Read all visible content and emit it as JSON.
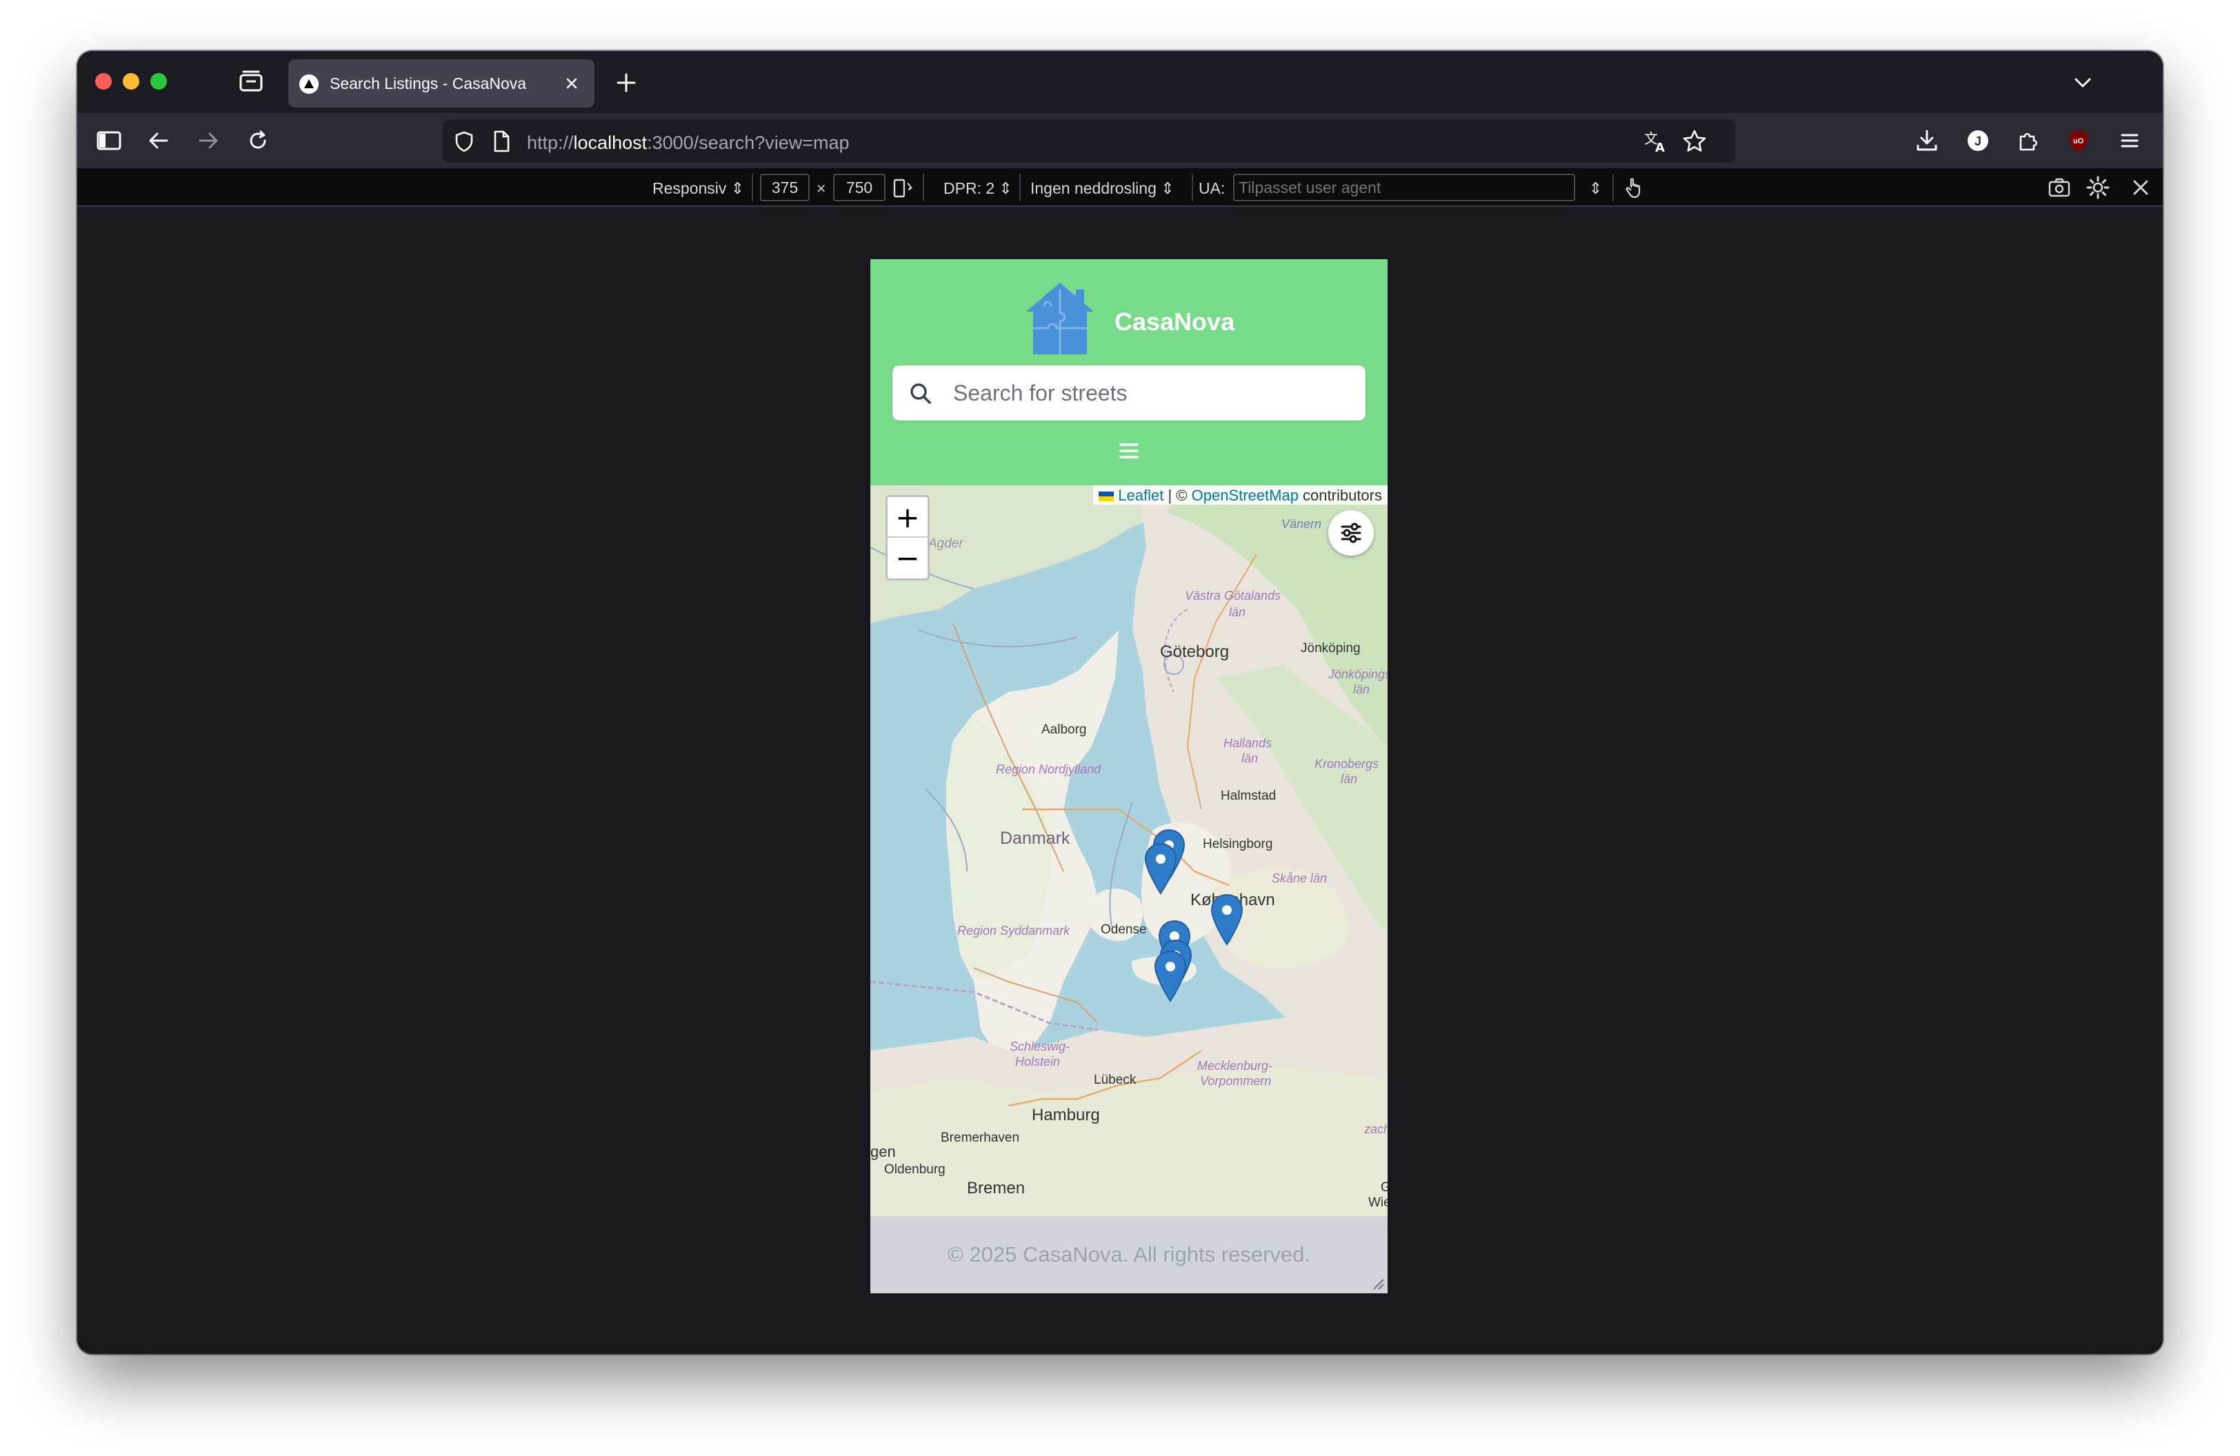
{
  "browser": {
    "tab": {
      "title": "Search Listings - CasaNova"
    },
    "url": {
      "scheme": "http://",
      "host": "localhost",
      "rest": ":3000/search?view=map"
    },
    "icons": {
      "translate": "translate-icon",
      "bookmark": "star-icon",
      "download": "download-icon",
      "account": "account-icon",
      "extensions": "puzzle-icon",
      "ublock": "ublock-icon",
      "menu": "menu-icon"
    }
  },
  "rdm": {
    "device": "Responsiv",
    "width": "375",
    "times": "×",
    "height": "750",
    "dpr": "DPR: 2",
    "throttle": "Ingen neddrosling",
    "ua_label": "UA:",
    "ua_placeholder": "Tilpasset user agent"
  },
  "app": {
    "brand": "CasaNova",
    "search_placeholder": "Search for streets",
    "footer": "© 2025 CasaNova. All rights reserved.",
    "colors": {
      "header": "#77db8a",
      "footer": "#d1d5db",
      "marker": "#2f7ccb"
    }
  },
  "map": {
    "attribution": {
      "leaflet": "Leaflet",
      "sep": " | © ",
      "osm": "OpenStreetMap",
      "suffix": " contributors"
    },
    "zoom_in": "+",
    "zoom_out": "−",
    "labels": [
      {
        "key": "agder",
        "text": "Agder"
      },
      {
        "key": "vanern",
        "text": "Vänern"
      },
      {
        "key": "vastra1",
        "text": "Västra Götalands"
      },
      {
        "key": "vastra2",
        "text": "län"
      },
      {
        "key": "goteborg",
        "text": "Göteborg"
      },
      {
        "key": "jonkoping",
        "text": "Jönköping"
      },
      {
        "key": "jonkopingslan1",
        "text": "Jönköpings"
      },
      {
        "key": "jonkopingslan2",
        "text": "län"
      },
      {
        "key": "aalborg",
        "text": "Aalborg"
      },
      {
        "key": "nordjylland",
        "text": "Region Nordjylland"
      },
      {
        "key": "hallands1",
        "text": "Hallands"
      },
      {
        "key": "hallands2",
        "text": "län"
      },
      {
        "key": "kronobergs1",
        "text": "Kronobergs"
      },
      {
        "key": "kronobergs2",
        "text": "län"
      },
      {
        "key": "halmstad",
        "text": "Halmstad"
      },
      {
        "key": "danmark",
        "text": "Danmark"
      },
      {
        "key": "helsingborg",
        "text": "Helsingborg"
      },
      {
        "key": "skane",
        "text": "Skåne län"
      },
      {
        "key": "kobenhavn",
        "text": "København"
      },
      {
        "key": "syddanmark",
        "text": "Region Syddanmark"
      },
      {
        "key": "odense",
        "text": "Odense"
      },
      {
        "key": "schleswig1",
        "text": "Schleswig-"
      },
      {
        "key": "schleswig2",
        "text": "Holstein"
      },
      {
        "key": "lubeck",
        "text": "Lübeck"
      },
      {
        "key": "mecklenburg1",
        "text": "Mecklenburg-"
      },
      {
        "key": "mecklenburg2",
        "text": "Vorpommern"
      },
      {
        "key": "hamburg",
        "text": "Hamburg"
      },
      {
        "key": "bremerhaven",
        "text": "Bremerhaven"
      },
      {
        "key": "oldenburg",
        "text": "Oldenburg"
      },
      {
        "key": "bremen",
        "text": "Bremen"
      },
      {
        "key": "gen",
        "text": "gen"
      },
      {
        "key": "zach",
        "text": "zach"
      },
      {
        "key": "wie",
        "text": "Wie"
      },
      {
        "key": "g",
        "text": "G"
      }
    ]
  }
}
